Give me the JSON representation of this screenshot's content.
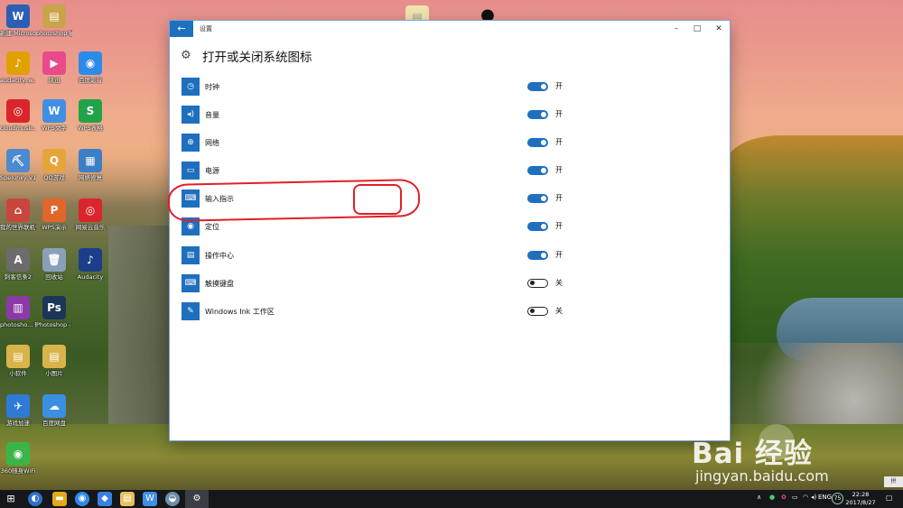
{
  "desktop_icons": [
    {
      "label": "新建 Microso...",
      "glyph": "W",
      "color": "#2b5fb3",
      "name": "word-doc"
    },
    {
      "label": "photoshop 破解文件及...",
      "glyph": "▤",
      "color": "#c9a44a",
      "name": "photoshop-crack-folder"
    },
    {
      "label": "audacity_w...",
      "glyph": "♪",
      "color": "#e0a000",
      "name": "audacity-installer"
    },
    {
      "label": "风迅",
      "glyph": "▶",
      "color": "#e84a8a",
      "name": "fengxun"
    },
    {
      "label": "百度影音",
      "glyph": "◉",
      "color": "#2d8be8",
      "name": "baidu-player"
    },
    {
      "label": "cloudmusic...",
      "glyph": "◎",
      "color": "#d9252b",
      "name": "cloudmusic-installer"
    },
    {
      "label": "WPS文字",
      "glyph": "W",
      "color": "#3f8fe3",
      "name": "wps-writer"
    },
    {
      "label": "WPS表格",
      "glyph": "S",
      "color": "#21a34a",
      "name": "wps-spreadsheet"
    },
    {
      "label": "Spelunky V1.4-Tran...",
      "glyph": "⛏",
      "color": "#4c8ad1",
      "name": "spelunky"
    },
    {
      "label": "QQ游戏",
      "glyph": "Q",
      "color": "#e6a53a",
      "name": "qq-game"
    },
    {
      "label": "网络修复",
      "glyph": "▦",
      "color": "#3b7fc8",
      "name": "network-repair"
    },
    {
      "label": "我的世界联机侠",
      "glyph": "⌂",
      "color": "#c8463c",
      "name": "minecraft-online"
    },
    {
      "label": "WPS演示",
      "glyph": "P",
      "color": "#e0662b",
      "name": "wps-presentation"
    },
    {
      "label": "网易云音乐",
      "glyph": "◎",
      "color": "#d9252b",
      "name": "netease-music"
    },
    {
      "label": "刺客信条2",
      "glyph": "A",
      "color": "#6c6c6c",
      "name": "assassins-creed-2"
    },
    {
      "label": "回收站",
      "glyph": "🗑",
      "color": "#8aa0b8",
      "name": "recycle-bin"
    },
    {
      "label": "Audacity",
      "glyph": "♪",
      "color": "#1c3e8a",
      "name": "audacity"
    },
    {
      "label": "photosho... 破解文件及...",
      "glyph": "▥",
      "color": "#8b3aa8",
      "name": "photoshop-crack-archive"
    },
    {
      "label": "Photoshop - 快捷方式",
      "glyph": "Ps",
      "color": "#1d3557",
      "name": "photoshop-shortcut"
    },
    {
      "label": "小软件",
      "glyph": "▤",
      "color": "#d9b44a",
      "name": "small-software-folder"
    },
    {
      "label": "小图片",
      "glyph": "▤",
      "color": "#d9b44a",
      "name": "small-pictures-folder"
    },
    {
      "label": "游戏加速",
      "glyph": "✈",
      "color": "#2e7bd6",
      "name": "game-accelerator"
    },
    {
      "label": "百度网盘",
      "glyph": "☁",
      "color": "#3a8fe0",
      "name": "baidu-netdisk"
    },
    {
      "label": "360随身WiFi",
      "glyph": "◉",
      "color": "#3bb54a",
      "name": "360-wifi"
    }
  ],
  "window": {
    "title": "设置",
    "back_glyph": "←",
    "minimize_glyph": "–",
    "maximize_glyph": "□",
    "close_glyph": "✕",
    "page_title": "打开或关闭系统图标",
    "gear_glyph": "⚙"
  },
  "items": [
    {
      "label": "时钟",
      "state": "开",
      "on": true,
      "icon_glyph": "◷",
      "icon_name": "clock-icon"
    },
    {
      "label": "音量",
      "state": "开",
      "on": true,
      "icon_glyph": "◂)",
      "icon_name": "volume-icon"
    },
    {
      "label": "网络",
      "state": "开",
      "on": true,
      "icon_glyph": "⊕",
      "icon_name": "network-icon"
    },
    {
      "label": "电源",
      "state": "开",
      "on": true,
      "icon_glyph": "▭",
      "icon_name": "battery-icon"
    },
    {
      "label": "输入指示",
      "state": "开",
      "on": true,
      "icon_glyph": "⌨",
      "icon_name": "keyboard-icon"
    },
    {
      "label": "定位",
      "state": "开",
      "on": true,
      "icon_glyph": "◉",
      "icon_name": "location-icon"
    },
    {
      "label": "操作中心",
      "state": "开",
      "on": true,
      "icon_glyph": "▤",
      "icon_name": "action-center-icon"
    },
    {
      "label": "触摸键盘",
      "state": "关",
      "on": false,
      "icon_glyph": "⌨",
      "icon_name": "touch-keyboard-icon"
    },
    {
      "label": "Windows Ink 工作区",
      "state": "关",
      "on": false,
      "icon_glyph": "✎",
      "icon_name": "windows-ink-icon"
    }
  ],
  "taskbar": {
    "start_glyph": "⊞",
    "language": "ENG",
    "badge": "75",
    "time": "22:28",
    "date": "2017/8/27",
    "side_tab": "拼"
  },
  "watermark": {
    "logo": "Bai 经验",
    "url": "jingyan.baidu.com"
  },
  "colors": {
    "accent": "#1f6fbf",
    "annotation": "#e0202a"
  }
}
